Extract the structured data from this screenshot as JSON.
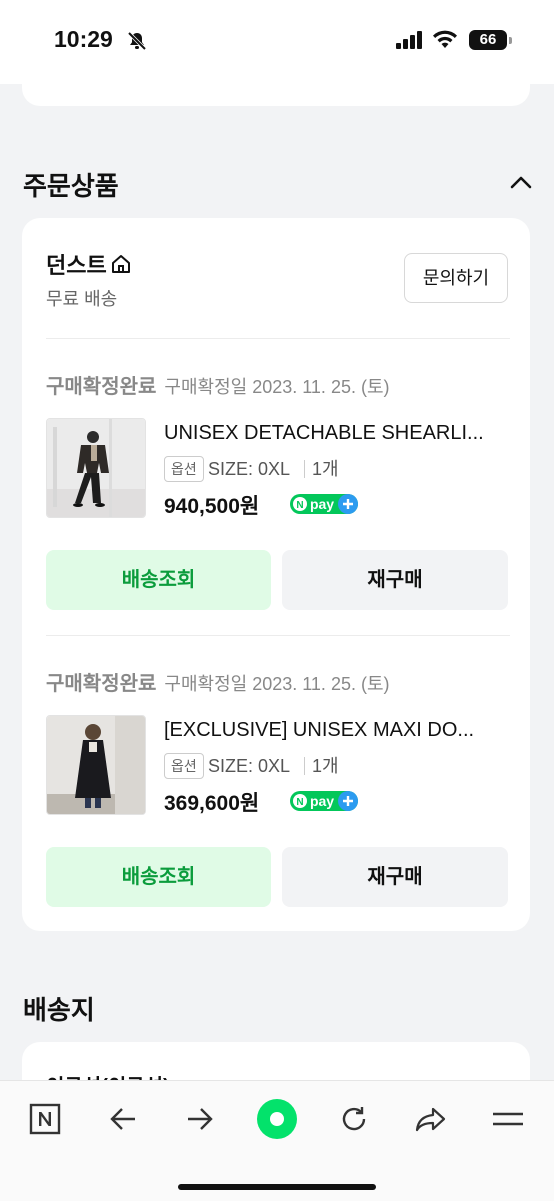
{
  "status_bar": {
    "time": "10:29",
    "battery": "66"
  },
  "section_order": {
    "title": "주문상품"
  },
  "seller": {
    "name": "던스트",
    "shipping": "무료 배송",
    "inquiry_label": "문의하기"
  },
  "orders": [
    {
      "status": "구매확정완료",
      "date": "구매확정일 2023. 11. 25. (토)",
      "product_name": "UNISEX DETACHABLE SHEARLI...",
      "option_badge": "옵션",
      "option": "SIZE: 0XL",
      "qty": "1개",
      "price": "940,500원",
      "npay_label": "pay",
      "track_label": "배송조회",
      "rebuy_label": "재구매"
    },
    {
      "status": "구매확정완료",
      "date": "구매확정일 2023. 11. 25. (토)",
      "product_name": "[EXCLUSIVE] UNISEX MAXI DO...",
      "option_badge": "옵션",
      "option": "SIZE: 0XL",
      "qty": "1개",
      "price": "369,600원",
      "npay_label": "pay",
      "track_label": "배송조회",
      "rebuy_label": "재구매"
    }
  ],
  "section_address": {
    "title": "배송지",
    "name_partial": "이규성(이규성)"
  },
  "bottom_nav": [
    "naver-home-icon",
    "back-arrow-icon",
    "forward-arrow-icon",
    "green-dot-icon",
    "refresh-icon",
    "share-icon",
    "menu-icon"
  ],
  "colors": {
    "accent_green": "#0b9c3c",
    "track_bg": "#e0fbe6",
    "npay_green": "#03c75a",
    "npay_blue": "#2c9bf0"
  }
}
